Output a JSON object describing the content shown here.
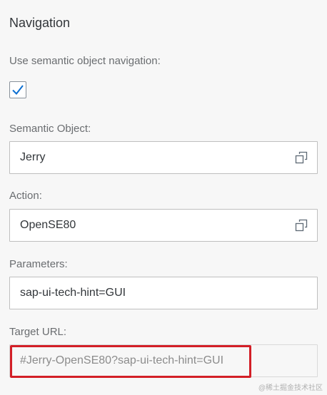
{
  "section": {
    "title": "Navigation"
  },
  "semantic_nav": {
    "label": "Use semantic object navigation:",
    "checked": true
  },
  "semantic_object": {
    "label": "Semantic Object:",
    "value": "Jerry",
    "icon": "value-help-icon"
  },
  "action": {
    "label": "Action:",
    "value": "OpenSE80",
    "icon": "value-help-icon"
  },
  "parameters": {
    "label": "Parameters:",
    "value": "sap-ui-tech-hint=GUI"
  },
  "target_url": {
    "label": "Target URL:",
    "value": "#Jerry-OpenSE80?sap-ui-tech-hint=GUI"
  },
  "watermark": "@稀土掘金技术社区",
  "colors": {
    "checkmark": "#0a6ed1",
    "highlight": "#d31f27",
    "background": "#f7f7f7"
  }
}
